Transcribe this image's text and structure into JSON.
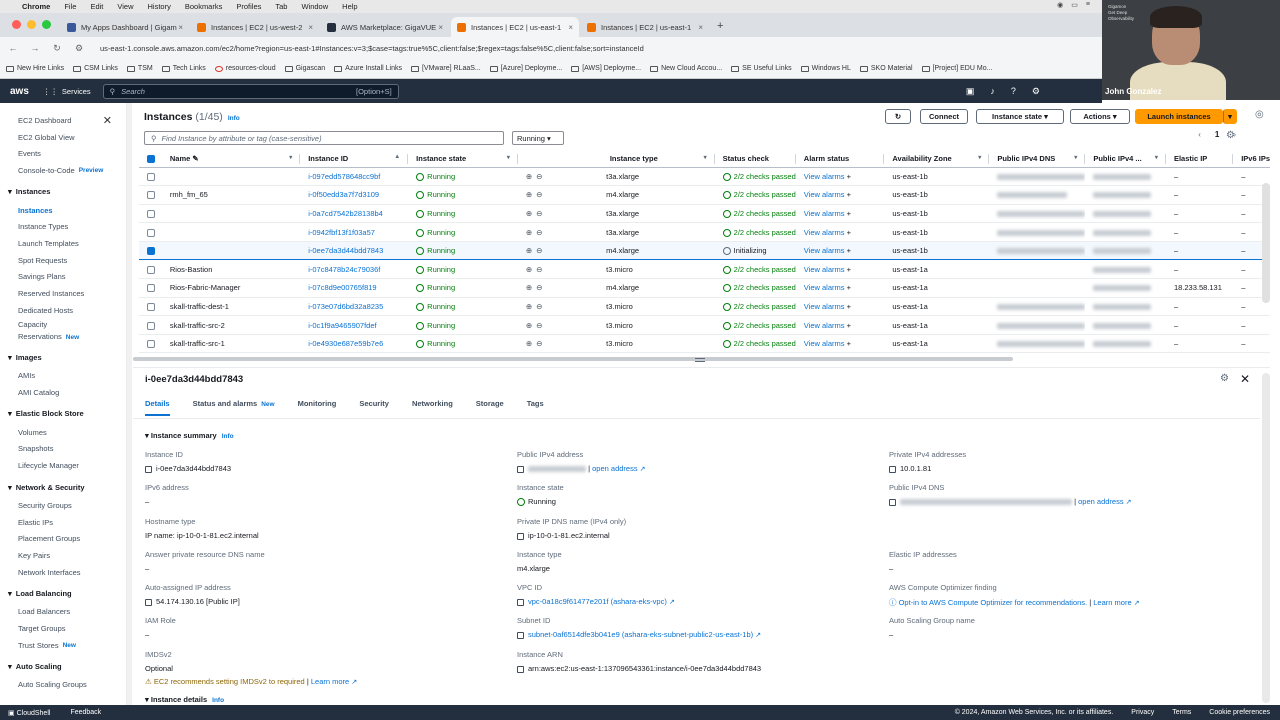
{
  "mac": {
    "app": "Chrome",
    "menus": [
      "File",
      "Edit",
      "View",
      "History",
      "Bookmarks",
      "Profiles",
      "Tab",
      "Window",
      "Help"
    ]
  },
  "tabs": [
    {
      "title": "My Apps Dashboard | Gigamo",
      "color": "#3b5998"
    },
    {
      "title": "Instances | EC2 | us-west-2",
      "color": "#ed7100"
    },
    {
      "title": "AWS Marketplace: GigaVUE Cl",
      "color": "#232f3e"
    },
    {
      "title": "Instances | EC2 | us-east-1",
      "color": "#ed7100",
      "active": true
    },
    {
      "title": "Instances | EC2 | us-east-1",
      "color": "#ed7100"
    }
  ],
  "address": "us-east-1.console.aws.amazon.com/ec2/home?region=us-east-1#Instances:v=3;$case=tags:true%5C,client:false;$regex=tags:false%5C,client:false;sort=instanceId",
  "bookmarks": [
    "New Hire Links",
    "CSM Links",
    "TSM",
    "Tech Links",
    "resources-cloud",
    "Gigascan",
    "Azure Install Links",
    "[VMware] RLaaS...",
    "[Azure] Deployme...",
    "[AWS] Deployme...",
    "New Cloud Accou...",
    "SE Useful Links",
    "Windows HL",
    "SKO Material",
    "[Project] EDU Mo..."
  ],
  "video": {
    "name": "John Gonzalez",
    "caption_top": "Gigamon",
    "caption_sub": "Get Deep Observability"
  },
  "aws": {
    "logo": "aws",
    "services": "Services",
    "search_placeholder": "Search",
    "search_shortcut": "[Option+S]"
  },
  "sidebar": {
    "top": [
      "EC2 Dashboard",
      "EC2 Global View",
      "Events",
      "Console-to-Code"
    ],
    "preview_badge": "Preview",
    "sections": [
      {
        "title": "Instances",
        "items": [
          "Instances",
          "Instance Types",
          "Launch Templates",
          "Spot Requests",
          "Savings Plans",
          "Reserved Instances",
          "Dedicated Hosts",
          "Capacity Reservations"
        ]
      },
      {
        "title": "Images",
        "items": [
          "AMIs",
          "AMI Catalog"
        ]
      },
      {
        "title": "Elastic Block Store",
        "items": [
          "Volumes",
          "Snapshots",
          "Lifecycle Manager"
        ]
      },
      {
        "title": "Network & Security",
        "items": [
          "Security Groups",
          "Elastic IPs",
          "Placement Groups",
          "Key Pairs",
          "Network Interfaces"
        ]
      },
      {
        "title": "Load Balancing",
        "items": [
          "Load Balancers",
          "Target Groups",
          "Trust Stores"
        ]
      },
      {
        "title": "Auto Scaling",
        "items": [
          "Auto Scaling Groups"
        ]
      }
    ],
    "new_badge": "New"
  },
  "page": {
    "title": "Instances",
    "count": "(1/45)",
    "info": "Info",
    "connect": "Connect",
    "instance_state": "Instance state",
    "actions": "Actions",
    "launch": "Launch instances",
    "find_placeholder": "Find Instance by attribute or tag (case-sensitive)",
    "filter": "Running",
    "page_num": "1"
  },
  "columns": [
    "Name",
    "Instance ID",
    "Instance state",
    "Instance type",
    "Status check",
    "Alarm status",
    "Availability Zone",
    "Public IPv4 DNS",
    "Public IPv4 ...",
    "Elastic IP",
    "IPv6 IPs"
  ],
  "rows": [
    {
      "name": "",
      "id": "i-097edd578648cc9bf",
      "state": "Running",
      "type": "t3a.xlarge",
      "check": "2/2 checks passed",
      "zone": "us-east-1b",
      "eip": "–",
      "ipv6": "–"
    },
    {
      "name": "rmh_fm_65",
      "id": "i-0f50edd3a7f7d3109",
      "state": "Running",
      "type": "m4.xlarge",
      "check": "2/2 checks passed",
      "zone": "us-east-1b",
      "eip": "–",
      "ipv6": "–"
    },
    {
      "name": "",
      "id": "i-0a7cd7542b28138b4",
      "state": "Running",
      "type": "t3a.xlarge",
      "check": "2/2 checks passed",
      "zone": "us-east-1b",
      "eip": "–",
      "ipv6": "–"
    },
    {
      "name": "",
      "id": "i-0942fbf13f1f03a57",
      "state": "Running",
      "type": "t3a.xlarge",
      "check": "2/2 checks passed",
      "zone": "us-east-1b",
      "eip": "–",
      "ipv6": "–"
    },
    {
      "name": "",
      "id": "i-0ee7da3d44bdd7843",
      "state": "Running",
      "type": "m4.xlarge",
      "check": "Initializing",
      "zone": "us-east-1b",
      "eip": "–",
      "ipv6": "–",
      "selected": true
    },
    {
      "name": "Rios-Bastion",
      "id": "i-07c8478b24c79036f",
      "state": "Running",
      "type": "t3.micro",
      "check": "2/2 checks passed",
      "zone": "us-east-1a",
      "eip": "–",
      "ipv6": "–"
    },
    {
      "name": "Rios-Fabric-Manager",
      "id": "i-07c8d9e00765f819",
      "state": "Running",
      "type": "m4.xlarge",
      "check": "2/2 checks passed",
      "zone": "us-east-1a",
      "eip": "18.233.58.131",
      "ipv6": "–"
    },
    {
      "name": "skall-traffic-dest-1",
      "id": "i-073e07d6bd32a8235",
      "state": "Running",
      "type": "t3.micro",
      "check": "2/2 checks passed",
      "zone": "us-east-1a",
      "eip": "–",
      "ipv6": "–"
    },
    {
      "name": "skall-traffic-src-2",
      "id": "i-0c1f9a9465907fdef",
      "state": "Running",
      "type": "t3.micro",
      "check": "2/2 checks passed",
      "zone": "us-east-1a",
      "eip": "–",
      "ipv6": "–"
    },
    {
      "name": "skall-traffic-src-1",
      "id": "i-0e4930e687e59b7e6",
      "state": "Running",
      "type": "t3.micro",
      "check": "2/2 checks passed",
      "zone": "us-east-1a",
      "eip": "–",
      "ipv6": "–"
    }
  ],
  "alarm_text": "View alarms",
  "detail": {
    "title": "i-0ee7da3d44bdd7843",
    "tabs": [
      "Details",
      "Status and alarms",
      "Monitoring",
      "Security",
      "Networking",
      "Storage",
      "Tags"
    ],
    "summary": "Instance summary",
    "fields": {
      "instance_id_l": "Instance ID",
      "instance_id": "i-0ee7da3d44bdd7843",
      "ipv6_l": "IPv6 address",
      "ipv6": "–",
      "hostname_l": "Hostname type",
      "hostname": "IP name: ip-10-0-1-81.ec2.internal",
      "answer_l": "Answer private resource DNS name",
      "answer": "–",
      "autoip_l": "Auto-assigned IP address",
      "autoip": "54.174.130.16 [Public IP]",
      "iam_l": "IAM Role",
      "iam": "–",
      "imds_l": "IMDSv2",
      "imds": "Optional",
      "imds_warn": "EC2 recommends setting IMDSv2 to required",
      "learn": "Learn more",
      "pubip_l": "Public IPv4 address",
      "open_address": "open address",
      "state_l": "Instance state",
      "state": "Running",
      "privdns_l": "Private IP DNS name (IPv4 only)",
      "privdns": "ip-10-0-1-81.ec2.internal",
      "type_l": "Instance type",
      "type": "m4.xlarge",
      "vpc_l": "VPC ID",
      "vpc": "vpc-0a18c9f61477e201f (ashara-eks-vpc)",
      "subnet_l": "Subnet ID",
      "subnet": "subnet-0af6514dfe3b041e9 (ashara-eks-subnet-public2-us-east-1b)",
      "arn_l": "Instance ARN",
      "arn": "arn:aws:ec2:us-east-1:137096543361:instance/i-0ee7da3d44bdd7843",
      "privip_l": "Private IPv4 addresses",
      "privip": "10.0.1.81",
      "pubdns_l": "Public IPv4 DNS",
      "eip_l": "Elastic IP addresses",
      "eip": "–",
      "opt_l": "AWS Compute Optimizer finding",
      "opt": "Opt-in to AWS Compute Optimizer for recommendations.",
      "asg_l": "Auto Scaling Group name",
      "asg": "–"
    },
    "next_section": "Instance details"
  },
  "footer": {
    "cloudshell": "CloudShell",
    "feedback": "Feedback",
    "copyright": "© 2024, Amazon Web Services, Inc. or its affiliates.",
    "privacy": "Privacy",
    "terms": "Terms",
    "cookies": "Cookie preferences"
  }
}
